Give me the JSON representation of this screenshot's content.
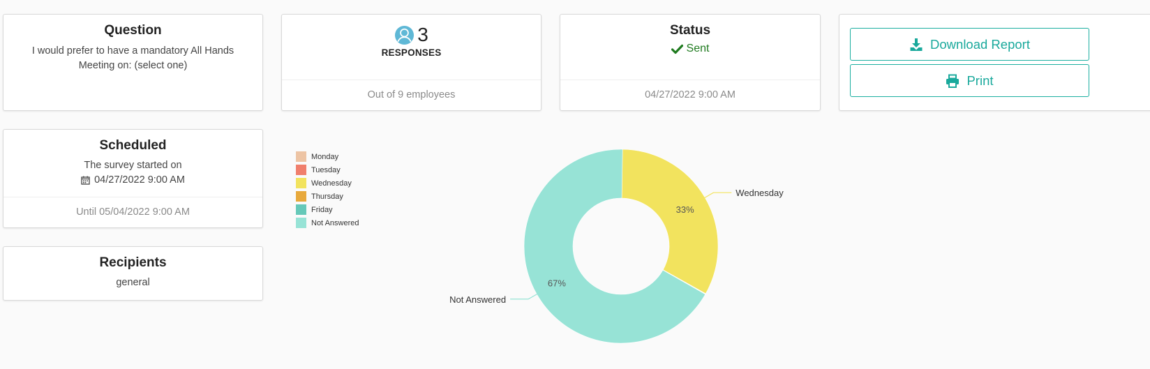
{
  "question": {
    "title": "Question",
    "text": "I would prefer to have a mandatory All Hands Meeting on: (select one)"
  },
  "responses": {
    "count": "3",
    "label": "RESPONSES",
    "footer": "Out of 9 employees"
  },
  "status": {
    "title": "Status",
    "value": "Sent",
    "footer": "04/27/2022 9:00 AM"
  },
  "actions": {
    "download_label": "Download Report",
    "print_label": "Print"
  },
  "scheduled": {
    "title": "Scheduled",
    "started_text": "The survey started on",
    "start_date": "04/27/2022 9:00 AM",
    "footer": "Until 05/04/2022 9:00 AM"
  },
  "recipients": {
    "title": "Recipients",
    "value": "general"
  },
  "colors": {
    "accent": "#1aa99c",
    "sent": "#1e7a1e",
    "avatar": "#5fb8d6"
  },
  "chart_data": {
    "type": "pie",
    "categories": [
      "Monday",
      "Tuesday",
      "Wednesday",
      "Thursday",
      "Friday",
      "Not Answered"
    ],
    "values": [
      0,
      0,
      33,
      0,
      0,
      67
    ],
    "colors": [
      "#edc4a4",
      "#f07f6c",
      "#f2e35e",
      "#e8a93c",
      "#66c9b9",
      "#97e3d6"
    ],
    "percent_labels": [
      "",
      "",
      "33%",
      "",
      "",
      "67%"
    ],
    "outer_labels": [
      "",
      "",
      "Wednesday",
      "",
      "",
      "Not Answered"
    ],
    "donut": true,
    "legend_position": "top-left"
  }
}
